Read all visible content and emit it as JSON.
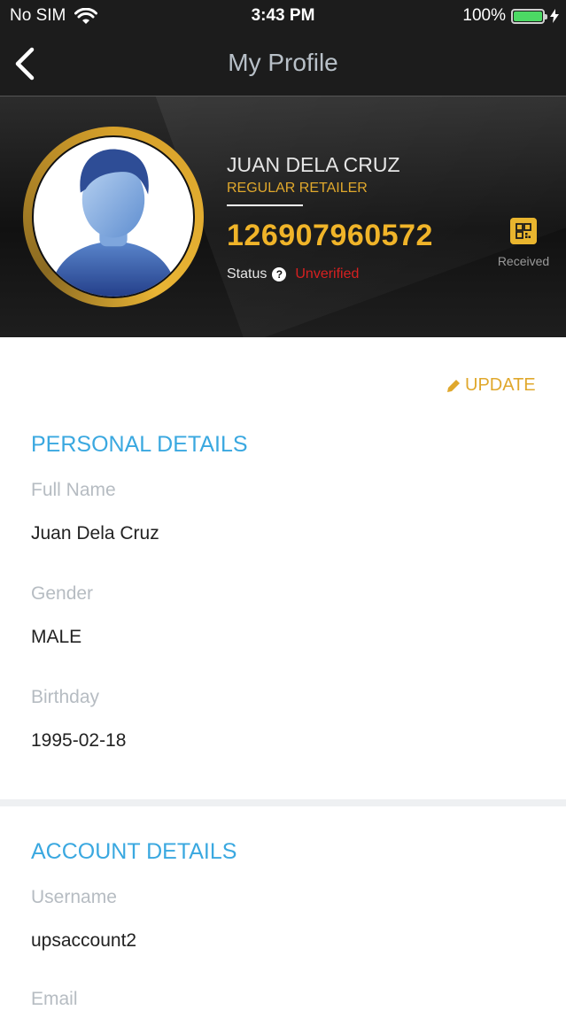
{
  "status_bar": {
    "carrier": "No SIM",
    "time": "3:43 PM",
    "battery": "100%",
    "battery_level": 1.0
  },
  "nav": {
    "title": "My Profile",
    "back_icon": "chevron-left-icon"
  },
  "profile": {
    "name": "JUAN DELA CRUZ",
    "user_type": "REGULAR RETAILER",
    "account_number": "126907960572",
    "status_label": "Status",
    "status_value": "Unverified",
    "received_label": "Received",
    "colors": {
      "accent": "#f0b429",
      "status_unverified": "#d62020"
    }
  },
  "actions": {
    "update_label": "UPDATE"
  },
  "personal_details": {
    "title": "PERSONAL DETAILS",
    "fields": [
      {
        "label": "Full Name",
        "value": "Juan Dela Cruz"
      },
      {
        "label": "Gender",
        "value": "MALE"
      },
      {
        "label": "Birthday",
        "value": "1995-02-18"
      }
    ]
  },
  "account_details": {
    "title": "ACCOUNT DETAILS",
    "fields": [
      {
        "label": "Username",
        "value": "upsaccount2"
      },
      {
        "label": "Email",
        "value": ""
      }
    ]
  },
  "section_title_color": "#3aa8e0"
}
